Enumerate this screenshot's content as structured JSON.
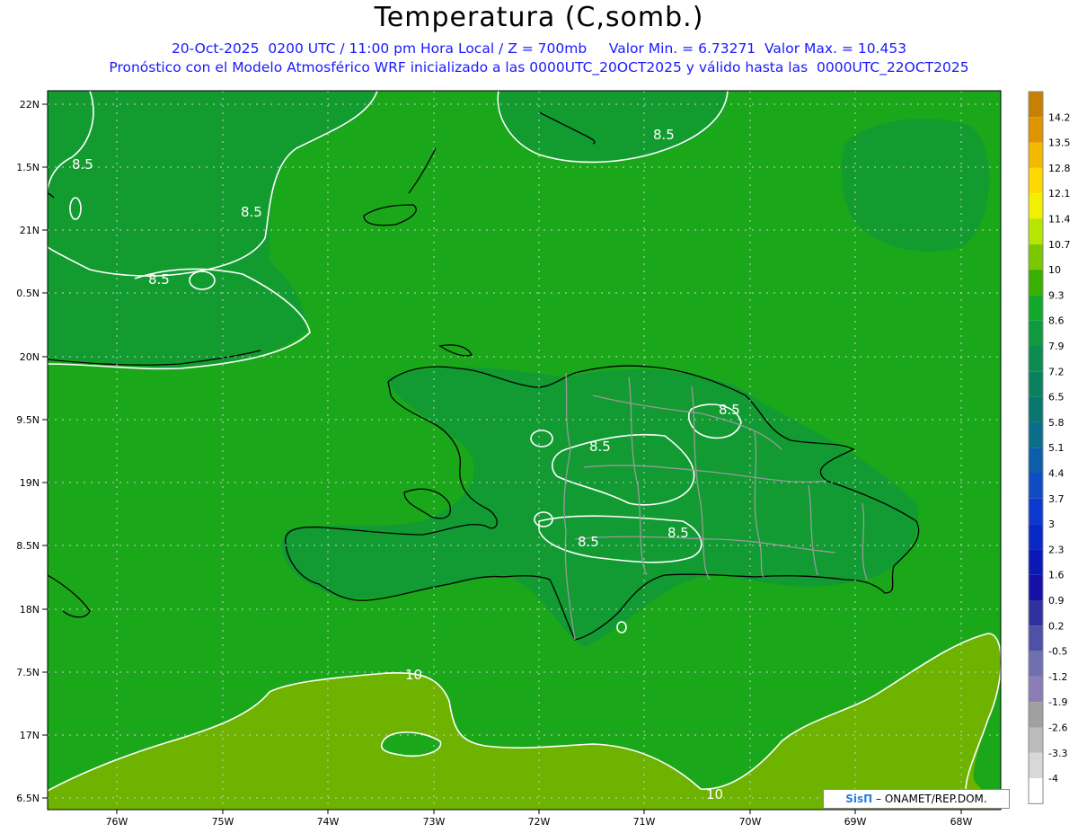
{
  "header": {
    "title": "Temperatura (C,somb.)",
    "line1": "20-Oct-2025  0200 UTC / 11:00 pm Hora Local / Z = 700mb     Valor Min. = 6.73271  Valor Max. = 10.453",
    "line2": "Pronóstico con el Modelo Atmosférico WRF inicializado a las 0000UTC_20OCT2025 y válido hasta las  0000UTC_22OCT2025"
  },
  "map": {
    "lat_labels": [
      "22N",
      "1.5N",
      "21N",
      "0.5N",
      "20N",
      "9.5N",
      "19N",
      "8.5N",
      "18N",
      "7.5N",
      "17N",
      "6.5N"
    ],
    "lon_labels": [
      "76W",
      "75W",
      "74W",
      "73W",
      "72W",
      "71W",
      "70W",
      "69W",
      "68W"
    ],
    "contour_labels": [
      "8.5",
      "8.5",
      "8.5",
      "8.5",
      "8.5",
      "8.5",
      "8.5",
      "8.5",
      "10",
      "10"
    ],
    "colors": {
      "land_field": "#1aa81a",
      "dark_field": "#0f9a28",
      "warm_field": "#6db300",
      "contour": "#ffffff",
      "coast": "#000000",
      "border": "#9a9a9a"
    }
  },
  "legend": {
    "labels": [
      "14.2",
      "13.5",
      "12.8",
      "12.1",
      "11.4",
      "10.7",
      "10",
      "9.3",
      "8.6",
      "7.9",
      "7.2",
      "6.5",
      "5.8",
      "5.1",
      "4.4",
      "3.7",
      "3",
      "2.3",
      "1.6",
      "0.9",
      "0.2",
      "-0.5",
      "-1.2",
      "-1.9",
      "-2.6",
      "-3.3",
      "-4"
    ],
    "colors": [
      "#c88000",
      "#e09400",
      "#f5b800",
      "#ffd800",
      "#f0f000",
      "#b4e600",
      "#7cc800",
      "#38b000",
      "#12a82a",
      "#0f9a40",
      "#0c8c50",
      "#0a8060",
      "#08766e",
      "#0a6e8a",
      "#0c5eaa",
      "#0d4cc4",
      "#0a38d0",
      "#0828c8",
      "#0a18b8",
      "#1410a8",
      "#3030a0",
      "#5050a8",
      "#7070b0",
      "#8c7cb8",
      "#a0a0a0",
      "#bcbcbc",
      "#d8d8d8",
      "#ffffff"
    ]
  },
  "credit": {
    "logo": "SisΠ",
    "text": " – ONAMET/REP.DOM."
  }
}
